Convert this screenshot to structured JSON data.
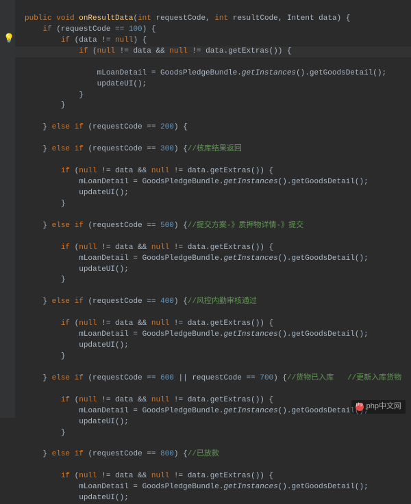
{
  "code": {
    "l1": {
      "kw1": "public",
      "kw2": "void",
      "name": "onResultData",
      "kw3": "int",
      "p1": "requestCode,",
      "kw4": "int",
      "p2": "resultCode, Intent data) {"
    },
    "l2": {
      "kw": "if",
      "txt": "(requestCode ==",
      "num": "100",
      "end": ") {"
    },
    "l3": {
      "kw": "if",
      "txt": "(data !=",
      "nul": "null",
      "end": ") {"
    },
    "l4": {
      "kw": "if",
      "open": "(",
      "nul1": "null",
      "txt1": "!= data &&",
      "nul2": "null",
      "txt2": "!= data.getExtras()) {"
    },
    "l5": {
      "a": "mLoanDetail = GoodsPledgeBundle.",
      "b": "getInstances",
      "c": "().getGoodsDetail();"
    },
    "l6": {
      "txt": "updateUI();"
    },
    "l7": {
      "txt": "}"
    },
    "l8": {
      "txt": "}"
    },
    "l9": "",
    "l10": {
      "txt": "}",
      "kw": "else if",
      "open": "(requestCode ==",
      "num": "200",
      "end": ") {"
    },
    "l11": "",
    "l12": {
      "txt": "}",
      "kw": "else if",
      "open": "(requestCode ==",
      "num": "300",
      "end": ") {",
      "cmt": "//核库结果返回"
    },
    "l13": "",
    "l14": {
      "kw": "if",
      "open": "(",
      "nul1": "null",
      "txt1": "!= data &&",
      "nul2": "null",
      "txt2": "!= data.getExtras()) {"
    },
    "l15": {
      "a": "mLoanDetail = GoodsPledgeBundle.",
      "b": "getInstances",
      "c": "().getGoodsDetail();"
    },
    "l16": {
      "txt": "updateUI();"
    },
    "l17": {
      "txt": "}"
    },
    "l18": "",
    "l19": {
      "txt": "}",
      "kw": "else if",
      "open": "(requestCode ==",
      "num": "500",
      "end": ") {",
      "cmt": "//提交方案-》质押物详情-》提交"
    },
    "l20": "",
    "l21": {
      "kw": "if",
      "open": "(",
      "nul1": "null",
      "txt1": "!= data &&",
      "nul2": "null",
      "txt2": "!= data.getExtras()) {"
    },
    "l22": {
      "a": "mLoanDetail = GoodsPledgeBundle.",
      "b": "getInstances",
      "c": "().getGoodsDetail();"
    },
    "l23": {
      "txt": "updateUI();"
    },
    "l24": {
      "txt": "}"
    },
    "l25": "",
    "l26": {
      "txt": "}",
      "kw": "else if",
      "open": "(requestCode ==",
      "num": "400",
      "end": ") {",
      "cmt": "//风控内勤审核通过"
    },
    "l27": "",
    "l28": {
      "kw": "if",
      "open": "(",
      "nul1": "null",
      "txt1": "!= data &&",
      "nul2": "null",
      "txt2": "!= data.getExtras()) {"
    },
    "l29": {
      "a": "mLoanDetail = GoodsPledgeBundle.",
      "b": "getInstances",
      "c": "().getGoodsDetail();"
    },
    "l30": {
      "txt": "updateUI();"
    },
    "l31": {
      "txt": "}"
    },
    "l32": "",
    "l33": {
      "txt": "}",
      "kw": "else if",
      "open": "(requestCode ==",
      "num1": "600",
      "mid": "|| requestCode ==",
      "num2": "700",
      "end": ") {",
      "cmt": "//货物已入库   //更新入库货物"
    },
    "l34": "",
    "l35": {
      "kw": "if",
      "open": "(",
      "nul1": "null",
      "txt1": "!= data &&",
      "nul2": "null",
      "txt2": "!= data.getExtras()) {"
    },
    "l36": {
      "a": "mLoanDetail = GoodsPledgeBundle.",
      "b": "getInstances",
      "c": "().getGoodsDetail();"
    },
    "l37": {
      "txt": "updateUI();"
    },
    "l38": {
      "txt": "}"
    },
    "l39": "",
    "l40": {
      "txt": "}",
      "kw": "else if",
      "open": "(requestCode ==",
      "num": "800",
      "end": ") {",
      "cmt": "//已放款"
    },
    "l41": "",
    "l42": {
      "kw": "if",
      "open": "(",
      "nul1": "null",
      "txt1": "!= data &&",
      "nul2": "null",
      "txt2": "!= data.getExtras()) {"
    },
    "l43": {
      "a": "mLoanDetail = GoodsPledgeBundle.",
      "b": "getInstances",
      "c": "().getGoodsDetail();"
    },
    "l44": {
      "txt": "updateUI();"
    }
  },
  "watermark": "php中文网"
}
